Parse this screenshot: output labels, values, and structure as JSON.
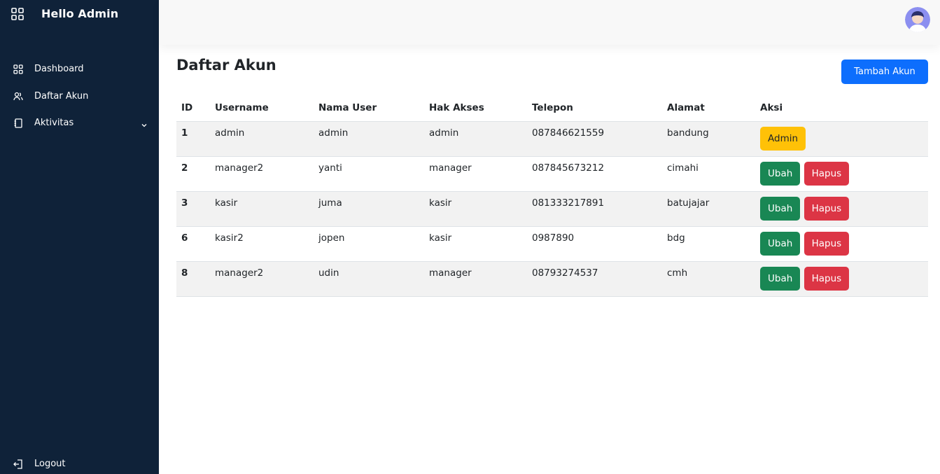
{
  "sidebar": {
    "brand_icon": "grid-icon",
    "title": "Hello Admin",
    "items": [
      {
        "label": "Dashboard",
        "icon": "grid-icon"
      },
      {
        "label": "Daftar Akun",
        "icon": "users-icon"
      },
      {
        "label": "Aktivitas",
        "icon": "notebook-icon"
      }
    ],
    "logout": {
      "label": "Logout",
      "icon": "logout-icon"
    }
  },
  "header": {
    "avatar": "user-avatar"
  },
  "main": {
    "title": "Daftar Akun",
    "add_button": "Tambah Akun",
    "table": {
      "columns": [
        "ID",
        "Username",
        "Nama User",
        "Hak Akses",
        "Telepon",
        "Alamat",
        "Aksi"
      ],
      "rows": [
        {
          "id": "1",
          "username": "admin",
          "nama": "admin",
          "akses": "admin",
          "telepon": "087846621559",
          "alamat": "bandung",
          "actions": [
            "Admin"
          ]
        },
        {
          "id": "2",
          "username": "manager2",
          "nama": "yanti",
          "akses": "manager",
          "telepon": "087845673212",
          "alamat": "cimahi",
          "actions": [
            "Ubah",
            "Hapus"
          ]
        },
        {
          "id": "3",
          "username": "kasir",
          "nama": "juma",
          "akses": "kasir",
          "telepon": "081333217891",
          "alamat": "batujajar",
          "actions": [
            "Ubah",
            "Hapus"
          ]
        },
        {
          "id": "6",
          "username": "kasir2",
          "nama": "jopen",
          "akses": "kasir",
          "telepon": "0987890",
          "alamat": "bdg",
          "actions": [
            "Ubah",
            "Hapus"
          ]
        },
        {
          "id": "8",
          "username": "manager2",
          "nama": "udin",
          "akses": "manager",
          "telepon": "08793274537",
          "alamat": "cmh",
          "actions": [
            "Ubah",
            "Hapus"
          ]
        }
      ]
    }
  },
  "colors": {
    "sidebar_bg": "#0f2239",
    "primary": "#0d6efd",
    "success": "#198754",
    "danger": "#dc3545",
    "warning": "#ffc107"
  }
}
